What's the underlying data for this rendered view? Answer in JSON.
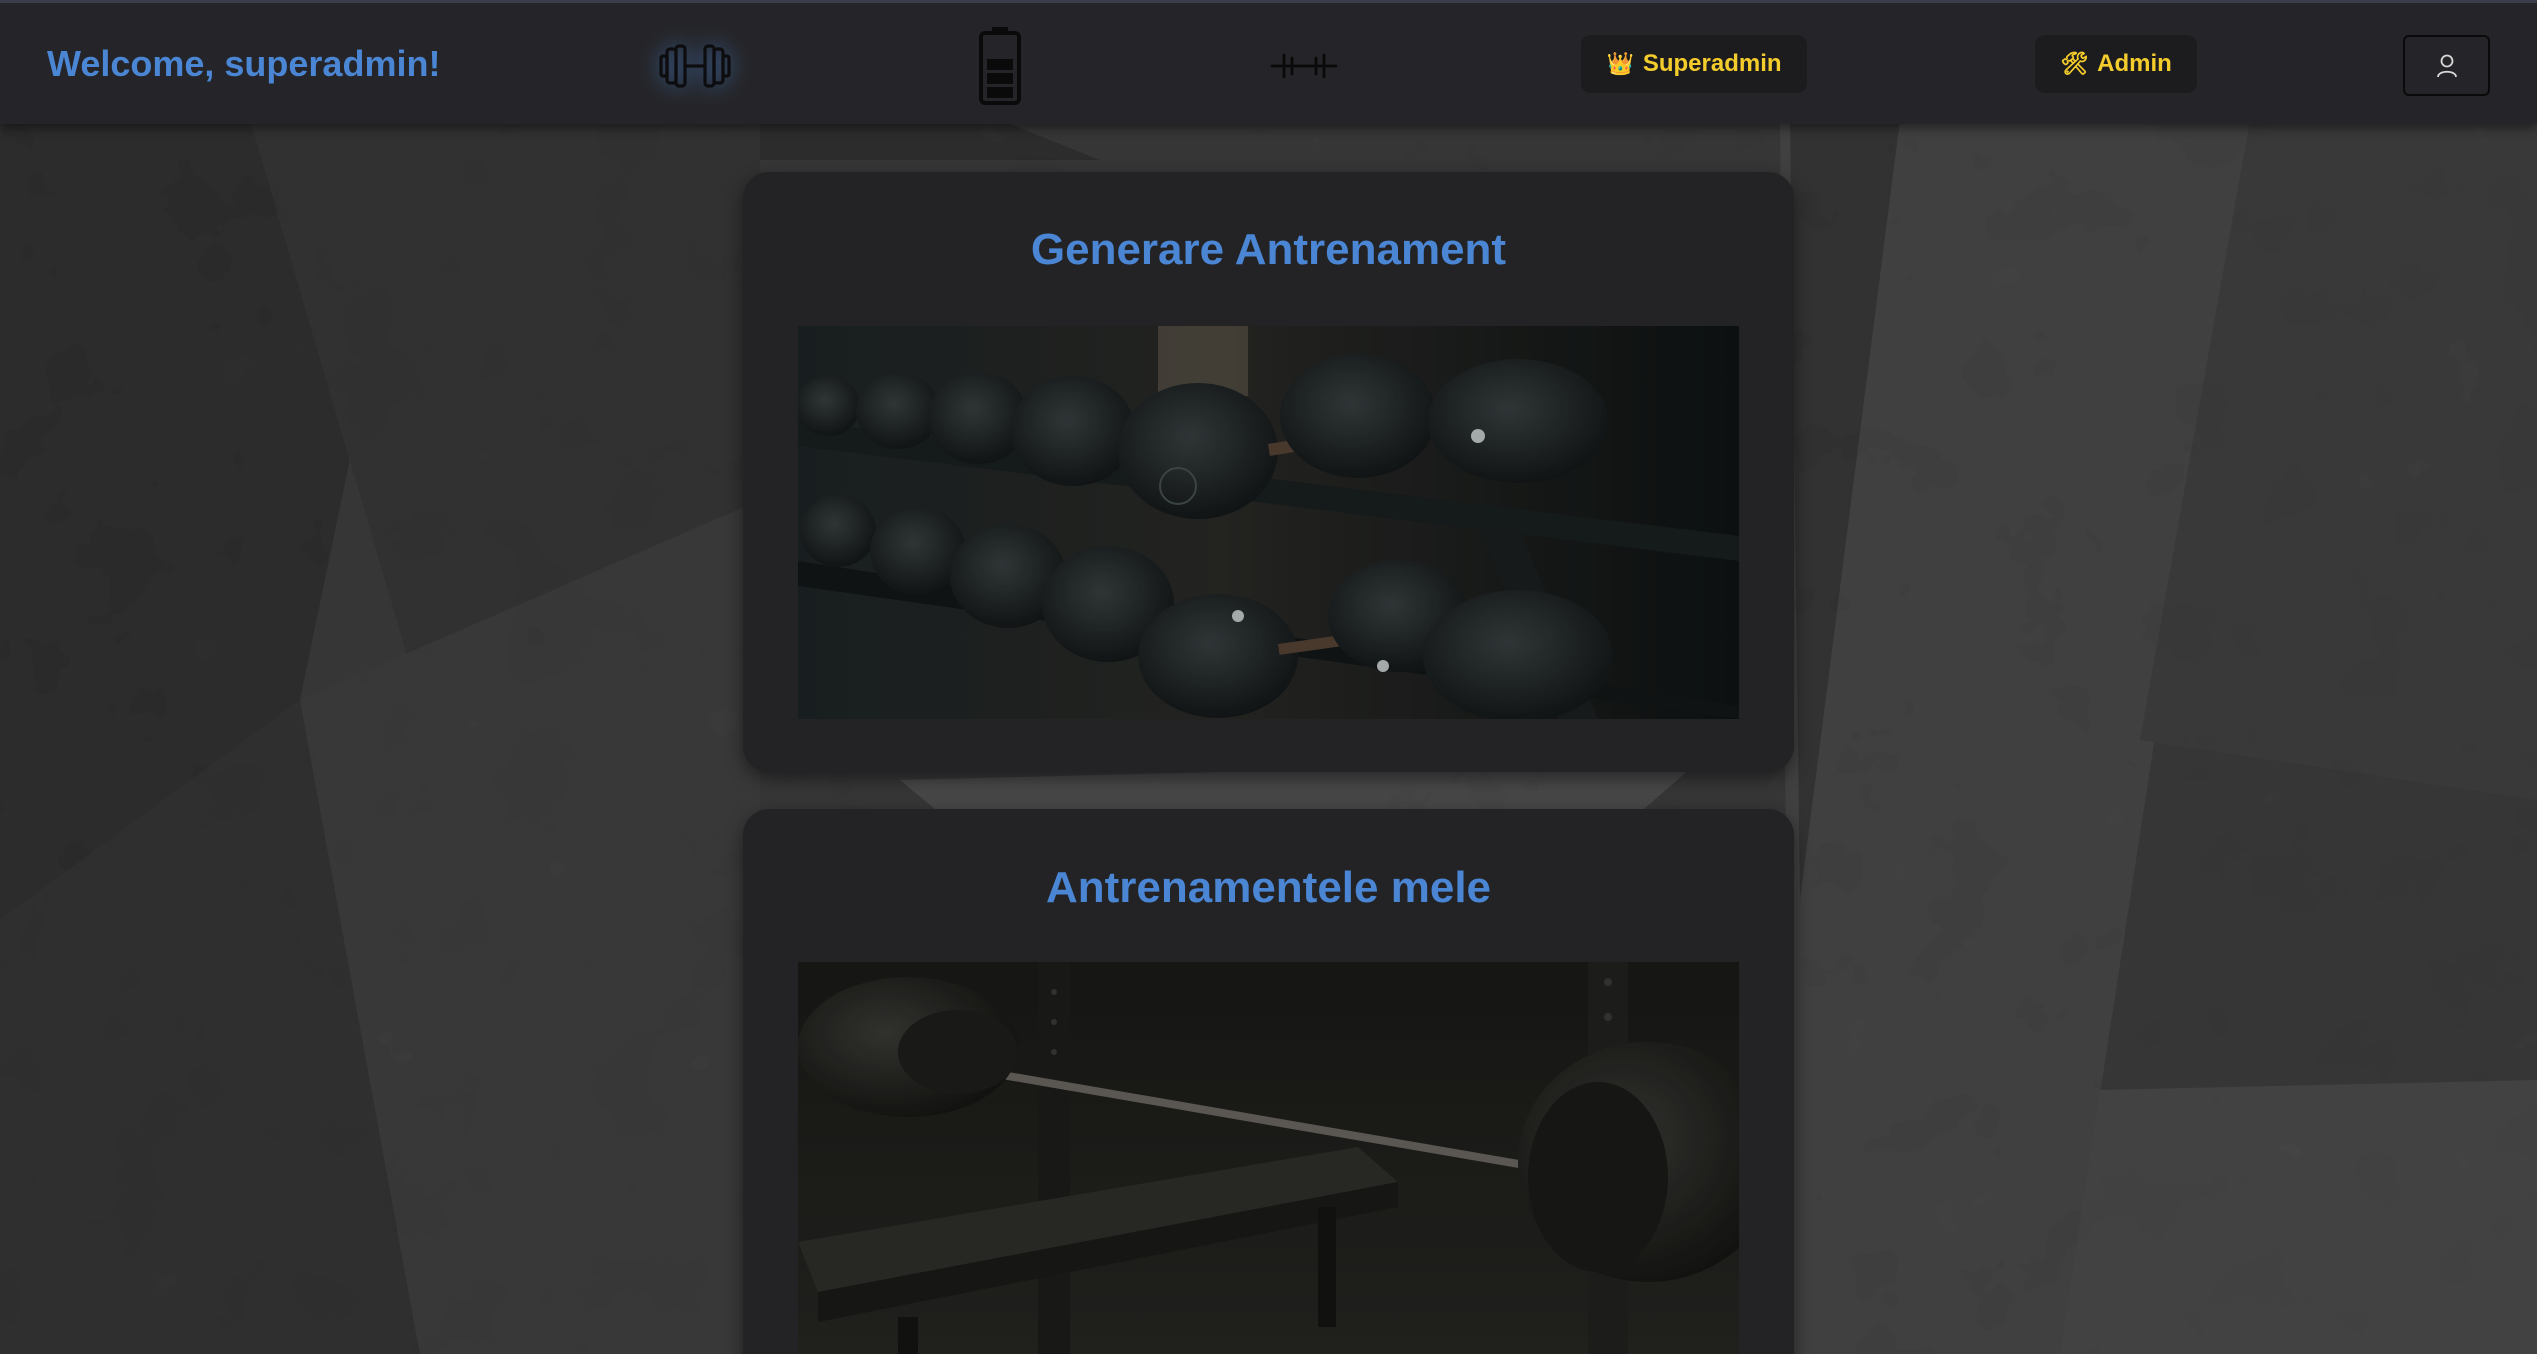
{
  "header": {
    "welcome_text": "Welcome, superadmin!",
    "icons": [
      "dumbbell-icon",
      "battery-icon",
      "barbell-icon"
    ],
    "superadmin_button": {
      "label": "Superadmin",
      "icon": "crown-icon"
    },
    "admin_button": {
      "label": "Admin",
      "icon": "hammer-wrench-icon"
    },
    "profile_button": {
      "icon": "user-icon"
    }
  },
  "cards": [
    {
      "title": "Generare Antrenament",
      "image": "dumbbell-rack-photo"
    },
    {
      "title": "Antrenamentele mele",
      "image": "bench-press-photo"
    }
  ],
  "colors": {
    "accent_blue": "#4a86d4",
    "role_yellow": "#f4cc2b",
    "navbar_bg": "#252529",
    "card_bg": "#232326"
  }
}
